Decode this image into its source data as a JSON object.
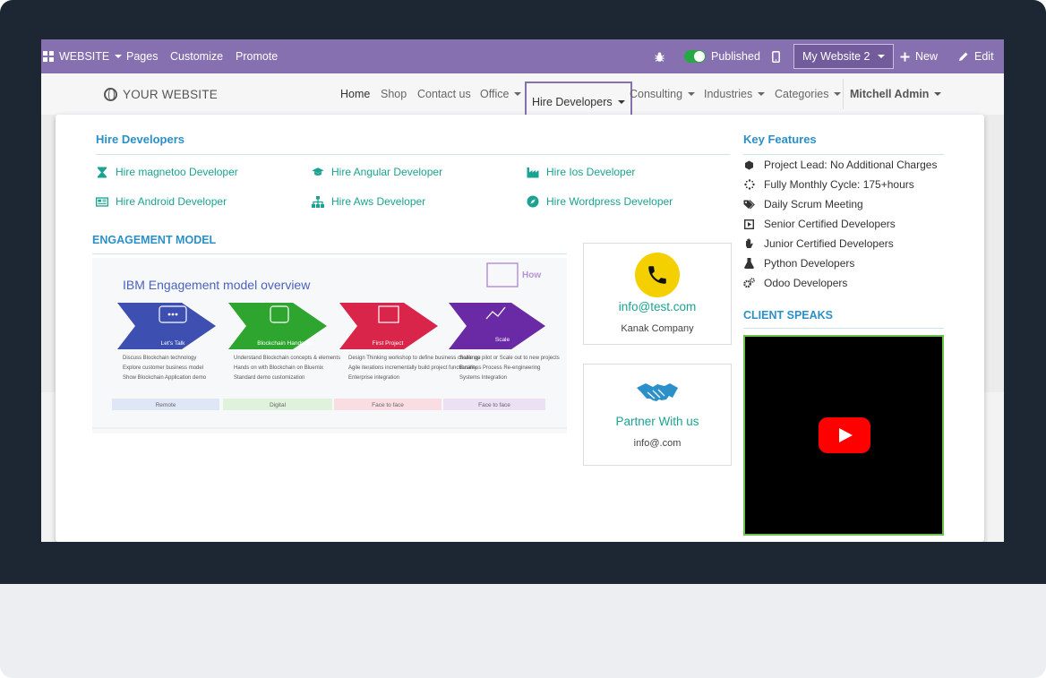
{
  "admin_bar": {
    "app_menu": "WEBSITE",
    "menu_items": [
      "Pages",
      "Customize",
      "Promote"
    ],
    "published_label": "Published",
    "site_selector": "My Website 2",
    "new_label": "New",
    "edit_label": "Edit",
    "bar_color": "#8670b0"
  },
  "navbar": {
    "logo_text": "YOUR WEBSITE",
    "links": [
      "Home",
      "Shop",
      "Contact us",
      "Office",
      "Hire Developers",
      "Consulting",
      "Industries",
      "Categories"
    ],
    "active_link": "Hire Developers",
    "user": "Mitchell Admin"
  },
  "mega_menu": {
    "hire_title": "Hire Developers",
    "developers": [
      {
        "label": "Hire magnetoo Developer",
        "icon": "hourglass-icon"
      },
      {
        "label": "Hire Angular Developer",
        "icon": "graduation-cap-icon"
      },
      {
        "label": "Hire Ios Developer",
        "icon": "industry-icon"
      },
      {
        "label": "Hire Android Developer",
        "icon": "newspaper-icon"
      },
      {
        "label": "Hire Aws Developer",
        "icon": "sitemap-icon"
      },
      {
        "label": "Hire Wordpress Developer",
        "icon": "compass-icon"
      }
    ],
    "engagement_title": "ENGAGEMENT MODEL",
    "engagement_image": {
      "title": "IBM Engagement model overview",
      "corner_label": "How",
      "stages": [
        {
          "name": "Let's Talk",
          "color": "#3d4fb0",
          "bullets": [
            "Discuss Blockchain technology",
            "Explore customer business model",
            "Show Blockchain Application demo"
          ],
          "footer": "Remote"
        },
        {
          "name": "Blockchain Hands-on",
          "color": "#2ea52f",
          "bullets": [
            "Understand Blockchain concepts & elements",
            "Hands on with Blockchain on Bluemix",
            "Standard demo customization"
          ],
          "footer": "Digital"
        },
        {
          "name": "First Project",
          "color": "#d9254a",
          "bullets": [
            "Design Thinking workshop to define business challenge",
            "Agile iterations incrementally build project functionality",
            "Enterprise integration"
          ],
          "footer": "Face to face"
        },
        {
          "name": "Scale",
          "color": "#6a2aa6",
          "bullets": [
            "Scale up pilot or Scale out to new projects",
            "Business Process Re-engineering",
            "Systems Integration"
          ],
          "footer": "Face to face"
        }
      ]
    },
    "contact_card": {
      "email": "info@test.com",
      "company": "Kanak Company",
      "icon": "phone-icon",
      "icon_bg": "#f5d000"
    },
    "partner_card": {
      "title": "Partner With us",
      "email": "info@.com",
      "icon": "handshake-icon"
    },
    "key_features_title": "Key Features",
    "key_features": [
      {
        "label": "Project Lead: No Additional Charges",
        "icon": "cube-icon"
      },
      {
        "label": "Fully Monthly Cycle: 175+hours",
        "icon": "spinner-icon"
      },
      {
        "label": "Daily Scrum Meeting",
        "icon": "tags-icon"
      },
      {
        "label": "Senior Certified Developers",
        "icon": "play-square-icon"
      },
      {
        "label": "Junior Certified Developers",
        "icon": "hand-icon"
      },
      {
        "label": "Python Developers",
        "icon": "flask-icon"
      },
      {
        "label": "Odoo Developers",
        "icon": "cogs-icon"
      }
    ],
    "client_speaks_title": "CLIENT SPEAKS",
    "video": {
      "icon": "youtube-play-icon",
      "border_color": "#6cc24a"
    }
  }
}
